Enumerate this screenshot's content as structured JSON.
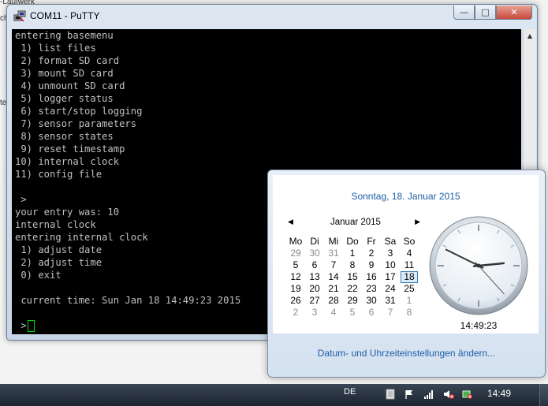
{
  "background": {
    "fragment_1": "-Laufwerk",
    "fragment_2": "ch",
    "fragment_3": "te"
  },
  "putty": {
    "title": "COM11 - PuTTY",
    "buttons": {
      "minimize": "—",
      "maximize": "□",
      "close": "✕"
    },
    "lines": [
      "entering basemenu",
      " 1) list files",
      " 2) format SD card",
      " 3) mount SD card",
      " 4) unmount SD card",
      " 5) logger status",
      " 6) start/stop logging",
      " 7) sensor parameters",
      " 8) sensor states",
      " 9) reset timestamp",
      "10) internal clock",
      "11) config file",
      "",
      " >",
      "your entry was: 10",
      "internal clock",
      "entering internal clock",
      " 1) adjust date",
      " 2) adjust time",
      " 0) exit",
      "",
      " current time: Sun Jan 18 14:49:23 2015",
      "",
      " >"
    ],
    "colors": {
      "background": "#000000",
      "text": "#c0c0c0",
      "cursor": "#00e000"
    }
  },
  "calendar": {
    "full_date": "Sonntag, 18. Januar 2015",
    "month_label": "Januar 2015",
    "prev_icon": "◀",
    "next_icon": "▶",
    "weekdays": [
      "Mo",
      "Di",
      "Mi",
      "Do",
      "Fr",
      "Sa",
      "So"
    ],
    "weeks": [
      [
        "29",
        "30",
        "31",
        "1",
        "2",
        "3",
        "4"
      ],
      [
        "5",
        "6",
        "7",
        "8",
        "9",
        "10",
        "11"
      ],
      [
        "12",
        "13",
        "14",
        "15",
        "16",
        "17",
        "18"
      ],
      [
        "19",
        "20",
        "21",
        "22",
        "23",
        "24",
        "25"
      ],
      [
        "26",
        "27",
        "28",
        "29",
        "30",
        "31",
        "1"
      ],
      [
        "2",
        "3",
        "4",
        "5",
        "6",
        "7",
        "8"
      ]
    ],
    "today": "18",
    "clock_time": "14:49:23",
    "clock_hands": {
      "hour": 14,
      "minute": 49,
      "second": 23
    },
    "settings_link": "Datum- und Uhrzeiteinstellungen ändern...",
    "accent": "#1e5ea8"
  },
  "taskbar": {
    "language": "DE",
    "clock": "14:49",
    "tray_icons": [
      "keyboard-icon",
      "flag-icon",
      "signal-icon",
      "speaker-muted-icon",
      "usb-icon"
    ]
  }
}
